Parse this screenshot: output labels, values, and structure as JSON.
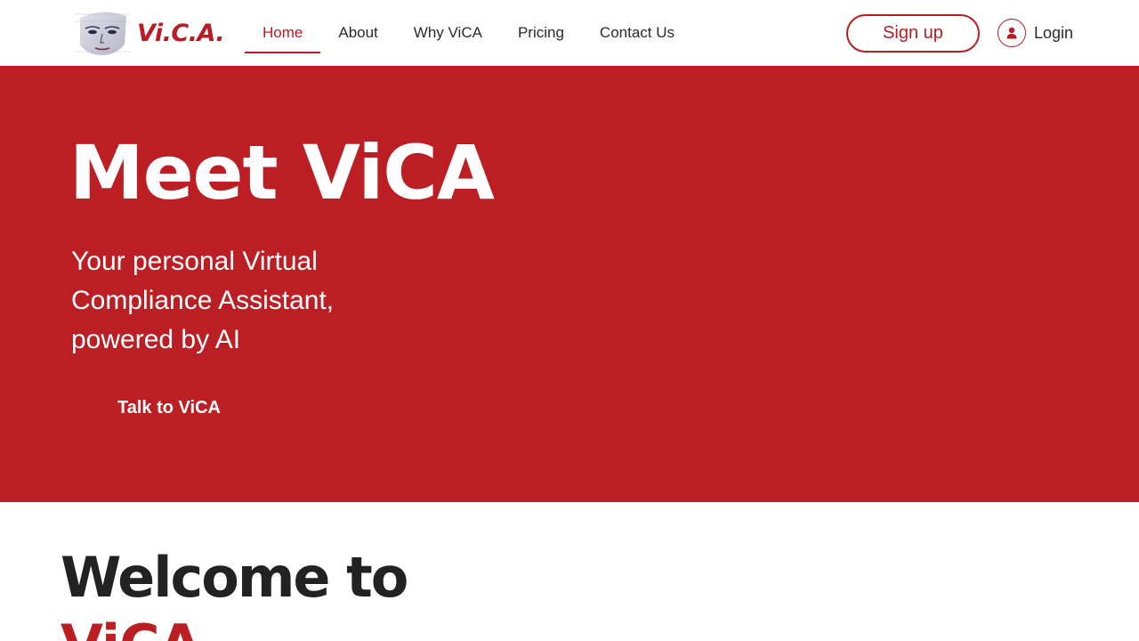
{
  "header": {
    "logo_text": "Vi.C.A.",
    "nav": [
      {
        "label": "Home",
        "active": true
      },
      {
        "label": "About",
        "active": false
      },
      {
        "label": "Why ViCA",
        "active": false
      },
      {
        "label": "Pricing",
        "active": false
      },
      {
        "label": "Contact Us",
        "active": false
      }
    ],
    "signup_label": "Sign up",
    "login_label": "Login",
    "login_icon": "user-icon"
  },
  "hero": {
    "title": "Meet ViCA",
    "subtitle": "Your personal Virtual Compliance Assistant, powered by AI",
    "cta_label": "Talk to ViCA"
  },
  "welcome": {
    "line1": "Welcome to",
    "line2": "ViCA"
  },
  "colors": {
    "brand": "#bb1f24",
    "text": "#222222",
    "background": "#ffffff"
  }
}
